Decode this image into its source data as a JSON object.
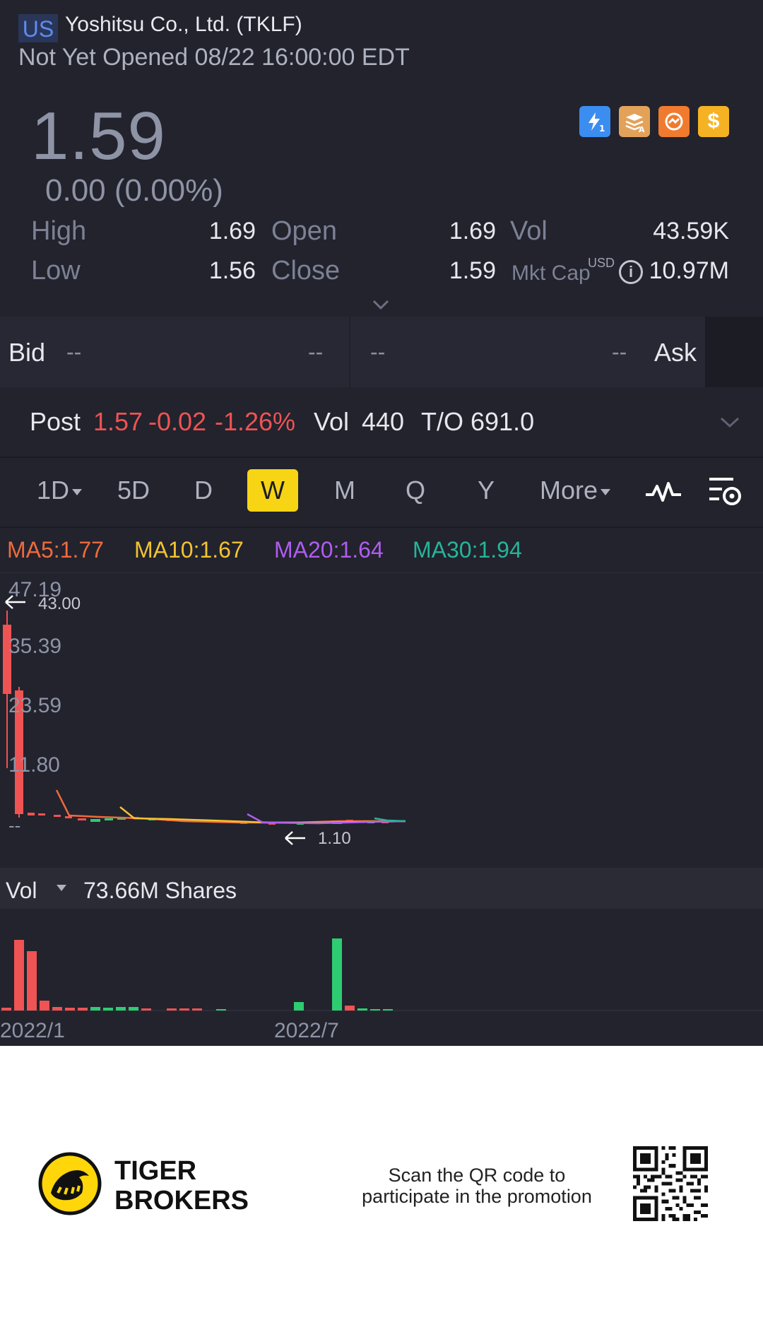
{
  "header": {
    "market": "US",
    "title": "Yoshitsu Co., Ltd. (TKLF)",
    "status": "Not Yet Opened 08/22 16:00:00 EDT"
  },
  "quote": {
    "price": "1.59",
    "change": "0.00 (0.00%)",
    "badges": [
      {
        "icon": "lightning-level1-icon",
        "color": "#3b8df0"
      },
      {
        "icon": "stack-a-icon",
        "color": "#e3a25a"
      },
      {
        "icon": "tiger-options-icon",
        "color": "#f07a2e"
      },
      {
        "icon": "dollar-icon",
        "color": "#f5b324"
      }
    ]
  },
  "stats": {
    "high_label": "High",
    "high": "1.69",
    "low_label": "Low",
    "low": "1.56",
    "open_label": "Open",
    "open": "1.69",
    "close_label": "Close",
    "close": "1.59",
    "vol_label": "Vol",
    "vol": "43.59K",
    "mktcap_label": "Mkt Cap",
    "mktcap_unit": "USD",
    "mktcap": "10.97M"
  },
  "bidask": {
    "bid_label": "Bid",
    "bid_price": "--",
    "bid_size": "--",
    "ask_price": "--",
    "ask_size": "--",
    "ask_label": "Ask"
  },
  "post": {
    "label": "Post",
    "price": "1.57",
    "change": "-0.02",
    "pct": "-1.26%",
    "vol_label": "Vol",
    "vol": "440",
    "to_label": "T/O",
    "to": "691.0"
  },
  "tabs": [
    {
      "label": "1D",
      "has_caret": true
    },
    {
      "label": "5D"
    },
    {
      "label": "D"
    },
    {
      "label": "W",
      "active": true
    },
    {
      "label": "M"
    },
    {
      "label": "Q"
    },
    {
      "label": "Y"
    },
    {
      "label": "More",
      "has_caret": true
    }
  ],
  "ma": {
    "ma5": "MA5:1.77",
    "ma5_color": "#f06a3c",
    "ma10": "MA10:1.67",
    "ma10_color": "#f2c331",
    "ma20": "MA20:1.64",
    "ma20_color": "#b05cf0",
    "ma30": "MA30:1.94",
    "ma30_color": "#25b59a"
  },
  "chart": {
    "y_labels": [
      "47.19",
      "35.39",
      "23.59",
      "11.80",
      "--"
    ],
    "high_marker": "43.00",
    "low_marker": "1.10",
    "x_labels": [
      "2022/1",
      "2022/7"
    ]
  },
  "volume": {
    "label": "Vol",
    "value": "73.66M Shares"
  },
  "footer": {
    "brand_line1": "TIGER",
    "brand_line2": "BROKERS",
    "scan_line1": "Scan the QR code to",
    "scan_line2": "participate in the promotion"
  }
}
